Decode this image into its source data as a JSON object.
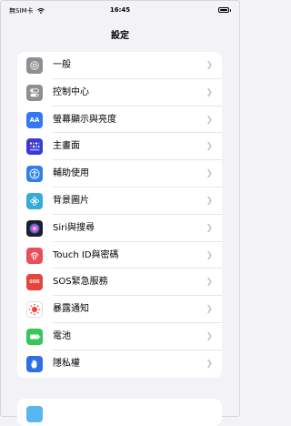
{
  "status_bar": {
    "carrier": "無SIM卡",
    "time": "16:45"
  },
  "nav": {
    "title": "設定"
  },
  "settings": [
    {
      "label": "一般",
      "icon": "gear-icon",
      "color": "#8e8e93"
    },
    {
      "label": "控制中心",
      "icon": "switches-icon",
      "color": "#8e8e93"
    },
    {
      "label": "螢幕顯示與亮度",
      "icon": "text-size-icon",
      "color": "#3478f6",
      "glyph": "AA"
    },
    {
      "label": "主畫面",
      "icon": "home-grid-icon",
      "color": "#3a3ad8"
    },
    {
      "label": "輔助使用",
      "icon": "accessibility-icon",
      "color": "#2f80ed"
    },
    {
      "label": "背景圖片",
      "icon": "wallpaper-icon",
      "color": "#35aadc"
    },
    {
      "label": "Siri與搜尋",
      "icon": "siri-icon",
      "color": "#1f1f2a"
    },
    {
      "label": "Touch ID與密碼",
      "icon": "fingerprint-icon",
      "color": "#eb4d5c"
    },
    {
      "label": "SOS緊急服務",
      "icon": "sos-icon",
      "color": "#e5453b",
      "glyph": "SOS"
    },
    {
      "label": "暴露通知",
      "icon": "exposure-icon",
      "color": "#ffffff"
    },
    {
      "label": "電池",
      "icon": "battery-icon",
      "color": "#34c759"
    },
    {
      "label": "隱私權",
      "icon": "hand-icon",
      "color": "#2f6fe4"
    }
  ]
}
